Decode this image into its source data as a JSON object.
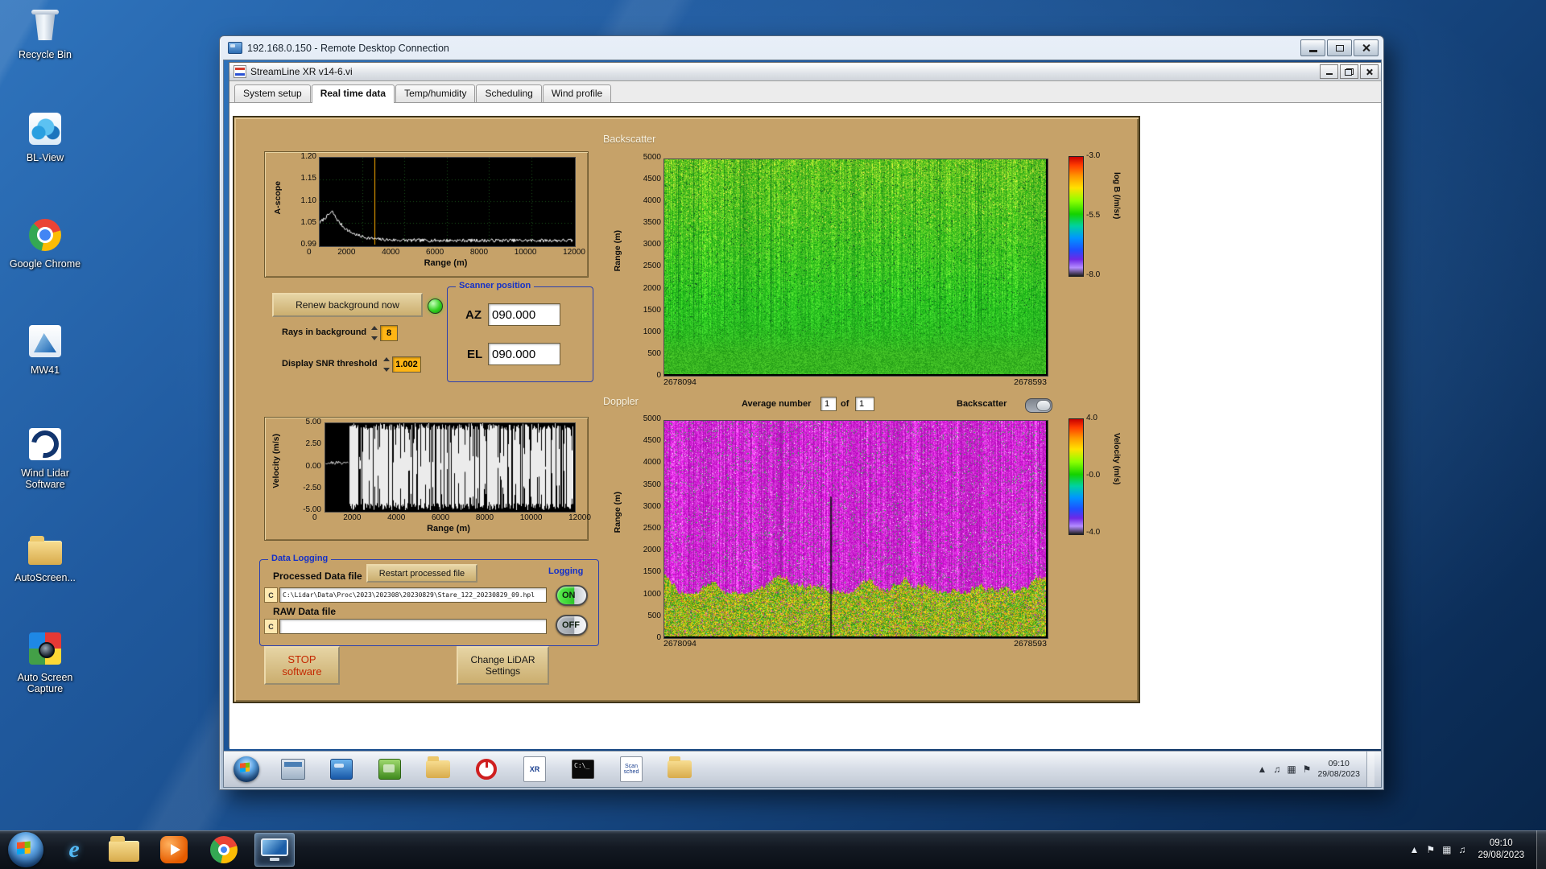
{
  "desktop": {
    "icons": [
      {
        "label": "Recycle Bin"
      },
      {
        "label": "BL-View"
      },
      {
        "label": "Google Chrome"
      },
      {
        "label": "MW41"
      },
      {
        "label": "Wind Lidar Software"
      },
      {
        "label": "AutoScreen..."
      },
      {
        "label": "Auto Screen Capture"
      }
    ]
  },
  "rdp": {
    "title": "192.168.0.150 - Remote Desktop Connection"
  },
  "app": {
    "title": "StreamLine XR v14-6.vi",
    "tabs": [
      {
        "label": "System setup"
      },
      {
        "label": "Real time data"
      },
      {
        "label": "Temp/humidity"
      },
      {
        "label": "Scheduling"
      },
      {
        "label": "Wind profile"
      }
    ]
  },
  "ascope": {
    "ylabel": "A-scope",
    "xlabel": "Range (m)",
    "y_ticks": [
      "1.20",
      "1.15",
      "1.10",
      "1.05",
      "0.99"
    ],
    "x_ticks": [
      "0",
      "2000",
      "4000",
      "6000",
      "8000",
      "10000",
      "12000"
    ]
  },
  "backscatter": {
    "title": "Backscatter",
    "ylabel": "Range (m)",
    "y_ticks": [
      "5000",
      "4500",
      "4000",
      "3500",
      "3000",
      "2500",
      "2000",
      "1500",
      "1000",
      "500",
      "0"
    ],
    "x_first": "2678094",
    "x_last": "2678593",
    "colorbar_label": "log B (/m/sr)",
    "colorbar_ticks": [
      "-3.0",
      "-5.5",
      "-8.0"
    ]
  },
  "controls": {
    "renew_button": "Renew background now",
    "rays_label": "Rays in background",
    "rays_value": "8",
    "snr_label": "Display SNR threshold",
    "snr_value": "1.002",
    "scanner_group": "Scanner position",
    "az_label": "AZ",
    "az_value": "090.000",
    "el_label": "EL",
    "el_value": "090.000"
  },
  "doppler": {
    "title": "Doppler",
    "average_label": "Average number",
    "average_value": "1",
    "of_label": "of",
    "average_total": "1",
    "toggle_label": "Backscatter",
    "ylabel": "Range (m)",
    "y_ticks": [
      "5000",
      "4500",
      "4000",
      "3500",
      "3000",
      "2500",
      "2000",
      "1500",
      "1000",
      "500",
      "0"
    ],
    "x_first": "2678094",
    "x_last": "2678593",
    "colorbar_label": "Velocity (m/s)",
    "colorbar_ticks": [
      "4.0",
      "-0.0",
      "-4.0"
    ]
  },
  "velocity": {
    "ylabel": "Velocity (m/s)",
    "xlabel": "Range (m)",
    "y_ticks": [
      "5.00",
      "2.50",
      "0.00",
      "-2.50",
      "-5.00"
    ],
    "x_ticks": [
      "0",
      "2000",
      "4000",
      "6000",
      "8000",
      "10000",
      "12000"
    ]
  },
  "logging": {
    "group_label": "Data Logging",
    "processed_label": "Processed Data file",
    "restart_button": "Restart processed file",
    "logging_label": "Logging",
    "drive_label": "C",
    "processed_path": "C:\\Lidar\\Data\\Proc\\2023\\202308\\20230829\\Stare_122_20230829_09.hpl",
    "raw_label": "RAW Data file",
    "raw_path": "",
    "on_label": "ON",
    "off_label": "OFF"
  },
  "footer_buttons": {
    "stop_line1": "STOP",
    "stop_line2": "software",
    "change_line1": "Change LiDAR",
    "change_line2": "Settings"
  },
  "remote_taskbar": {
    "xr_icon_text": "XR",
    "scan_icon_line1": "Scan",
    "scan_icon_line2": "sched",
    "terminal_icon_text": "C:\\_",
    "tray": [
      {
        "glyph": "▲"
      },
      {
        "glyph": "♫"
      },
      {
        "glyph": "▦"
      },
      {
        "glyph": "⚑"
      }
    ],
    "clock_time": "09:10",
    "clock_date": "29/08/2023"
  },
  "host_taskbar": {
    "tray": [
      {
        "glyph": "▲"
      },
      {
        "glyph": "⚑"
      },
      {
        "glyph": "▦"
      },
      {
        "glyph": "♫"
      }
    ],
    "clock_time": "09:10",
    "clock_date": "29/08/2023"
  }
}
